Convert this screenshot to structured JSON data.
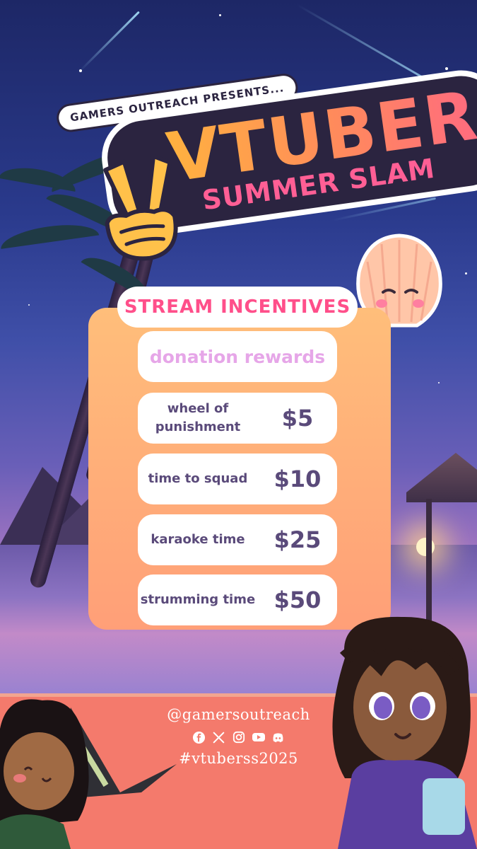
{
  "title": {
    "presents": "GAMERS OUTREACH PRESENTS...",
    "main": "VTUBER",
    "sub": "SUMMER SLAM"
  },
  "incentives": {
    "header": "STREAM INCENTIVES",
    "section_label": "donation rewards",
    "rewards": [
      {
        "name": "wheel of punishment",
        "price": "$5"
      },
      {
        "name": "time to squad",
        "price": "$10"
      },
      {
        "name": "karaoke time",
        "price": "$25"
      },
      {
        "name": "strumming time",
        "price": "$50"
      }
    ]
  },
  "socials": {
    "handle": "@gamersoutreach",
    "icons": [
      "facebook-icon",
      "x-icon",
      "instagram-icon",
      "youtube-icon",
      "discord-icon"
    ],
    "hashtag": "#vtuberss2025"
  },
  "colors": {
    "accent_pink": "#ff4f8a",
    "card_gradient_top": "#ffbe7a",
    "card_gradient_bottom": "#ff9f78",
    "reward_text": "#5a4a7a",
    "bottom_band": "#f47a6c"
  }
}
